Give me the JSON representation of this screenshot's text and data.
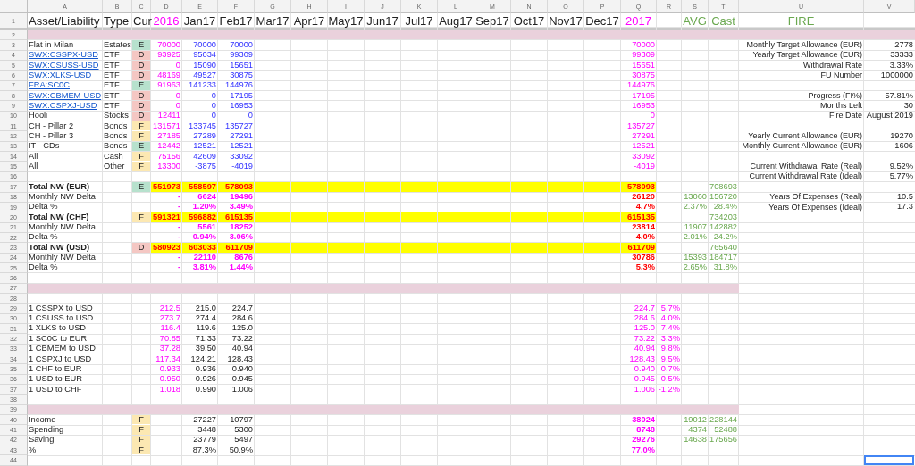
{
  "columns": [
    "A",
    "B",
    "C",
    "D",
    "E",
    "F",
    "G",
    "H",
    "I",
    "J",
    "K",
    "L",
    "M",
    "N",
    "O",
    "P",
    "Q",
    "R",
    "S",
    "T",
    "U",
    "V"
  ],
  "rows": [
    {
      "n": "1",
      "kind": "header",
      "label": "Asset/Liability",
      "type": "Type",
      "cur": {
        "text": "Cur"
      },
      "y2016": "2016",
      "months": [
        "Jan17",
        "Feb17",
        "Mar17",
        "Apr17",
        "May17",
        "Jun17",
        "Jul17",
        "Aug17",
        "Sep17",
        "Oct17",
        "Nov17",
        "Dec17"
      ],
      "y2017": "2017",
      "avg": "AVG",
      "cast": "Cast",
      "fire_label": "FIRE"
    },
    {
      "n": "2",
      "kind": "band",
      "full_width": true
    },
    {
      "n": "3",
      "kind": "asset",
      "label": "Flat in Milan",
      "link": false,
      "type": "Estates",
      "cur": {
        "text": "E",
        "color": "#b7e1cd"
      },
      "y2016": "70000",
      "jan17": "70000",
      "feb17": "70000",
      "y2017": "70000",
      "fire_label": "Monthly Target Allowance (EUR)",
      "fire_value": "2778"
    },
    {
      "n": "4",
      "kind": "asset",
      "label": "SWX:CSSPX-USD",
      "link": true,
      "type": "ETF",
      "cur": {
        "text": "D",
        "color": "#f4c7c3"
      },
      "y2016": "93925",
      "jan17": "95034",
      "feb17": "99309",
      "y2017": "99309",
      "fire_label": "Yearly Target Allowance (EUR)",
      "fire_value": "33333"
    },
    {
      "n": "5",
      "kind": "asset",
      "label": "SWX:CSUSS-USD",
      "link": true,
      "type": "ETF",
      "cur": {
        "text": "D",
        "color": "#f4c7c3"
      },
      "y2016": "0",
      "jan17": "15090",
      "feb17": "15651",
      "y2017": "15651",
      "fire_label": "Withdrawal Rate",
      "fire_value": "3.33%"
    },
    {
      "n": "6",
      "kind": "asset",
      "label": "SWX:XLKS-USD",
      "link": true,
      "type": "ETF",
      "cur": {
        "text": "D",
        "color": "#f4c7c3"
      },
      "y2016": "48169",
      "jan17": "49527",
      "feb17": "30875",
      "y2017": "30875",
      "fire_label": "FU Number",
      "fire_value": "1000000"
    },
    {
      "n": "7",
      "kind": "asset",
      "label": "FRA:SC0C",
      "link": true,
      "type": "ETF",
      "cur": {
        "text": "E",
        "color": "#b7e1cd"
      },
      "y2016": "91963",
      "jan17": "141233",
      "feb17": "144976",
      "y2017": "144976"
    },
    {
      "n": "8",
      "kind": "asset",
      "label": "SWX:CBMEM-USD",
      "link": true,
      "type": "ETF",
      "cur": {
        "text": "D",
        "color": "#f4c7c3"
      },
      "y2016": "0",
      "jan17": "0",
      "feb17": "17195",
      "y2017": "17195",
      "fire_label": "Progress (FI%)",
      "fire_value": "57.81%"
    },
    {
      "n": "9",
      "kind": "asset",
      "label": "SWX:CSPXJ-USD",
      "link": true,
      "type": "ETF",
      "cur": {
        "text": "D",
        "color": "#f4c7c3"
      },
      "y2016": "0",
      "jan17": "0",
      "feb17": "16953",
      "y2017": "16953",
      "fire_label": "Months Left",
      "fire_value": "30"
    },
    {
      "n": "10",
      "kind": "asset",
      "label": "Hooli",
      "link": false,
      "type": "Stocks",
      "cur": {
        "text": "D",
        "color": "#f4c7c3"
      },
      "y2016": "12411",
      "jan17": "0",
      "feb17": "0",
      "y2017": "0",
      "fire_label": "Fire Date",
      "fire_value": "August 2019"
    },
    {
      "n": "11",
      "kind": "asset",
      "label": "CH - Pillar 2",
      "link": false,
      "type": "Bonds",
      "cur": {
        "text": "F",
        "color": "#fce8b2"
      },
      "y2016": "131571",
      "jan17": "133745",
      "feb17": "135727",
      "y2017": "135727"
    },
    {
      "n": "12",
      "kind": "asset",
      "label": "CH - Pillar 3",
      "link": false,
      "type": "Bonds",
      "cur": {
        "text": "F",
        "color": "#fce8b2"
      },
      "y2016": "27185",
      "jan17": "27289",
      "feb17": "27291",
      "y2017": "27291",
      "fire_label": "Yearly Current Allowance (EUR)",
      "fire_value": "19270"
    },
    {
      "n": "13",
      "kind": "asset",
      "label": "IT - CDs",
      "link": false,
      "type": "Bonds",
      "cur": {
        "text": "E",
        "color": "#b7e1cd"
      },
      "y2016": "12442",
      "jan17": "12521",
      "feb17": "12521",
      "y2017": "12521",
      "fire_label": "Monthly Current Allowance (EUR)",
      "fire_value": "1606"
    },
    {
      "n": "14",
      "kind": "asset",
      "label": "All",
      "link": false,
      "type": "Cash",
      "cur": {
        "text": "F",
        "color": "#fce8b2"
      },
      "y2016": "75156",
      "jan17": "42609",
      "feb17": "33092",
      "y2017": "33092"
    },
    {
      "n": "15",
      "kind": "asset",
      "label": "All",
      "link": false,
      "type": "Other",
      "cur": {
        "text": "F",
        "color": "#fce8b2"
      },
      "y2016": "13300",
      "jan17": "-3875",
      "feb17": "-4019",
      "y2017": "-4019",
      "fire_label": "Current Withdrawal Rate (Real)",
      "fire_value": "9.52%"
    },
    {
      "n": "16",
      "kind": "blank",
      "fire_label": "Current Withdrawal Rate (Ideal)",
      "fire_value": "5.77%"
    },
    {
      "n": "17",
      "kind": "total",
      "label": "Total NW (EUR)",
      "cur": {
        "text": "E",
        "color": "#b7e1cd"
      },
      "y2016": "551973",
      "jan17": "558597",
      "feb17": "578093",
      "y2017": "578093",
      "cast": "708693"
    },
    {
      "n": "18",
      "kind": "delta",
      "label": "Monthly NW Delta",
      "y2016": "-",
      "jan17": "6624",
      "feb17": "19496",
      "y2017": "26120",
      "avg": "13060",
      "cast": "156720",
      "fire_label": "Years Of Expenses (Real)",
      "fire_value": "10.5"
    },
    {
      "n": "19",
      "kind": "delta",
      "label": "Delta %",
      "y2016": "-",
      "jan17": "1.20%",
      "feb17": "3.49%",
      "y2017": "4.7%",
      "avg": "2.37%",
      "cast": "28.4%",
      "fire_label": "Years Of Expenses (Ideal)",
      "fire_value": "17.3"
    },
    {
      "n": "20",
      "kind": "total",
      "label": "Total NW (CHF)",
      "cur": {
        "text": "F",
        "color": "#fce8b2"
      },
      "y2016": "591321",
      "jan17": "596882",
      "feb17": "615135",
      "y2017": "615135",
      "cast": "734203"
    },
    {
      "n": "21",
      "kind": "delta",
      "label": "Monthly NW Delta",
      "y2016": "-",
      "jan17": "5561",
      "feb17": "18252",
      "y2017": "23814",
      "avg": "11907",
      "cast": "142882"
    },
    {
      "n": "22",
      "kind": "delta",
      "label": "Delta %",
      "y2016": "-",
      "jan17": "0.94%",
      "feb17": "3.06%",
      "y2017": "4.0%",
      "avg": "2.01%",
      "cast": "24.2%"
    },
    {
      "n": "23",
      "kind": "total",
      "label": "Total NW (USD)",
      "cur": {
        "text": "D",
        "color": "#f4c7c3"
      },
      "y2016": "580923",
      "jan17": "603033",
      "feb17": "611709",
      "y2017": "611709",
      "cast": "765640"
    },
    {
      "n": "24",
      "kind": "delta",
      "label": "Monthly NW Delta",
      "y2016": "-",
      "jan17": "22110",
      "feb17": "8676",
      "y2017": "30786",
      "avg": "15393",
      "cast": "184717"
    },
    {
      "n": "25",
      "kind": "delta",
      "label": "Delta %",
      "y2016": "-",
      "jan17": "3.81%",
      "feb17": "1.44%",
      "y2017": "5.3%",
      "avg": "2.65%",
      "cast": "31.8%"
    },
    {
      "n": "26",
      "kind": "blank"
    },
    {
      "n": "27",
      "kind": "band",
      "full_width": false
    },
    {
      "n": "28",
      "kind": "blank"
    },
    {
      "n": "29",
      "kind": "rate",
      "label": "1 CSSPX to USD",
      "y2016": "212.5",
      "jan17": "215.0",
      "feb17": "224.7",
      "y2017": "224.7",
      "change": "5.7%"
    },
    {
      "n": "30",
      "kind": "rate",
      "label": "1 CSUSS to USD",
      "y2016": "273.7",
      "jan17": "274.4",
      "feb17": "284.6",
      "y2017": "284.6",
      "change": "4.0%"
    },
    {
      "n": "31",
      "kind": "rate",
      "label": "1 XLKS to USD",
      "y2016": "116.4",
      "jan17": "119.6",
      "feb17": "125.0",
      "y2017": "125.0",
      "change": "7.4%"
    },
    {
      "n": "32",
      "kind": "rate",
      "label": "1 SC0C to EUR",
      "y2016": "70.85",
      "jan17": "71.33",
      "feb17": "73.22",
      "y2017": "73.22",
      "change": "3.3%"
    },
    {
      "n": "33",
      "kind": "rate",
      "label": "1 CBMEM to USD",
      "y2016": "37.28",
      "jan17": "39.50",
      "feb17": "40.94",
      "y2017": "40.94",
      "change": "9.8%"
    },
    {
      "n": "34",
      "kind": "rate",
      "label": "1 CSPXJ to USD",
      "y2016": "117.34",
      "jan17": "124.21",
      "feb17": "128.43",
      "y2017": "128.43",
      "change": "9.5%"
    },
    {
      "n": "35",
      "kind": "rate",
      "label": "1 CHF to EUR",
      "y2016": "0.933",
      "jan17": "0.936",
      "feb17": "0.940",
      "y2017": "0.940",
      "change": "0.7%"
    },
    {
      "n": "36",
      "kind": "rate",
      "label": "1 USD to EUR",
      "y2016": "0.950",
      "jan17": "0.926",
      "feb17": "0.945",
      "y2017": "0.945",
      "change": "-0.5%"
    },
    {
      "n": "37",
      "kind": "rate",
      "label": "1 USD to CHF",
      "y2016": "1.018",
      "jan17": "0.990",
      "feb17": "1.006",
      "y2017": "1.006",
      "change": "-1.2%"
    },
    {
      "n": "38",
      "kind": "blank"
    },
    {
      "n": "39",
      "kind": "band",
      "full_width": false
    },
    {
      "n": "40",
      "kind": "flow",
      "label": "Income",
      "cur": {
        "text": "F",
        "color": "#fce8b2"
      },
      "jan17": "27227",
      "feb17": "10797",
      "y2017": "38024",
      "avg": "19012",
      "cast": "228144"
    },
    {
      "n": "41",
      "kind": "flow",
      "label": "Spending",
      "cur": {
        "text": "F",
        "color": "#fce8b2"
      },
      "jan17": "3448",
      "feb17": "5300",
      "y2017": "8748",
      "avg": "4374",
      "cast": "52488"
    },
    {
      "n": "42",
      "kind": "flow",
      "label": "Saving",
      "cur": {
        "text": "F",
        "color": "#fce8b2"
      },
      "jan17": "23779",
      "feb17": "5497",
      "y2017": "29276",
      "avg": "14638",
      "cast": "175656"
    },
    {
      "n": "43",
      "kind": "flow",
      "label": "%",
      "cur": {
        "text": "F",
        "color": "#fce8b2"
      },
      "jan17": "87.3%",
      "feb17": "50.9%",
      "y2017": "77.0%"
    },
    {
      "n": "44",
      "kind": "blank",
      "fire_value_selected": true
    }
  ]
}
